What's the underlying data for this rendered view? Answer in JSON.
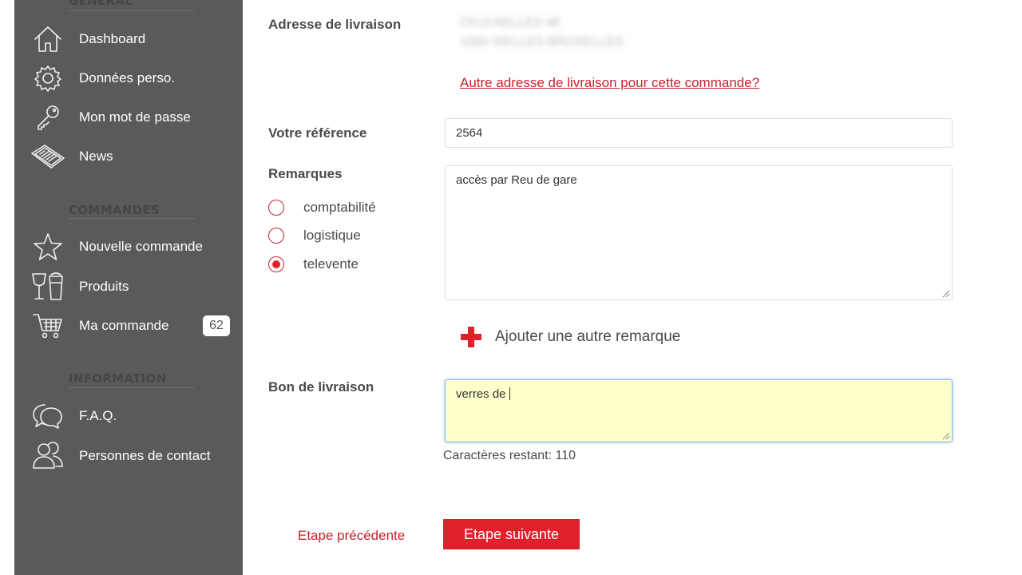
{
  "sidebar": {
    "sections": {
      "general": "GÉNÉRAL",
      "commandes": "COMMANDES",
      "information": "INFORMATION"
    },
    "items": [
      {
        "label": "Dashboard",
        "icon": "home-icon"
      },
      {
        "label": "Données perso.",
        "icon": "gear-icon"
      },
      {
        "label": "Mon mot de passe",
        "icon": "key-icon"
      },
      {
        "label": "News",
        "icon": "newspaper-icon"
      },
      {
        "label": "Nouvelle commande",
        "icon": "star-icon"
      },
      {
        "label": "Produits",
        "icon": "glasses-icon"
      },
      {
        "label": "Ma commande",
        "icon": "cart-icon",
        "badge": "62"
      },
      {
        "label": "F.A.Q.",
        "icon": "chat-bubbles-icon"
      },
      {
        "label": "Personnes de contact",
        "icon": "people-icon"
      }
    ]
  },
  "form": {
    "delivery_address_label": "Adresse de livraison",
    "delivery_address_lines": [
      "CH.D'AELLES 46",
      "1050 IXELLES-BRUXELLES"
    ],
    "other_address_link": "Autre adresse de livraison pour cette commande?",
    "reference_label": "Votre référence",
    "reference_value": "2564",
    "remarks_label": "Remarques",
    "remark_options": [
      {
        "label": "comptabilité",
        "selected": false
      },
      {
        "label": "logistique",
        "selected": false
      },
      {
        "label": "televente",
        "selected": true
      }
    ],
    "remark_text": "accès par Reu de gare",
    "add_remark_label": "Ajouter une autre remarque",
    "delivery_note_label": "Bon de livraison",
    "delivery_note_value": "verres de ",
    "chars_remaining": "Caractères restant: 110"
  },
  "actions": {
    "prev_label": "Etape précédente",
    "next_label": "Etape suivante"
  },
  "colors": {
    "sidebar_bg": "#5a5a5a",
    "accent_red": "#e0202b",
    "link_red": "#c8232c",
    "highlight_input_bg": "#ffffcc",
    "highlight_input_border": "#7fb6e6"
  }
}
